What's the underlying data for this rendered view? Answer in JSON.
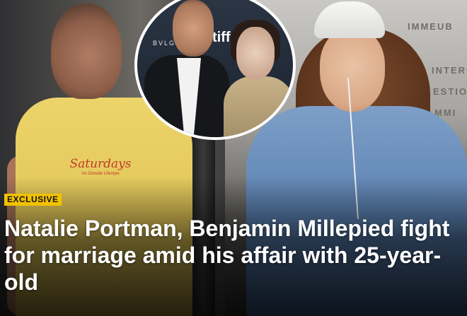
{
  "article": {
    "badge": "EXCLUSIVE",
    "headline": "Natalie Portman, Benjamin Millepied fight for marriage amid his affair with 25-year-old"
  },
  "photo": {
    "shirt_text": "Saturdays",
    "shirt_subtext": "An Outside Lifestyle",
    "inset_logo_text": "tiff",
    "inset_brand_text": "BVLGARI",
    "wall_texts": [
      "IMMEUB",
      "INTER",
      "ESTIO",
      "MMI"
    ]
  },
  "colors": {
    "badge_bg": "#f2c200",
    "headline_text": "#ffffff",
    "inset_border": "#ffffff"
  }
}
